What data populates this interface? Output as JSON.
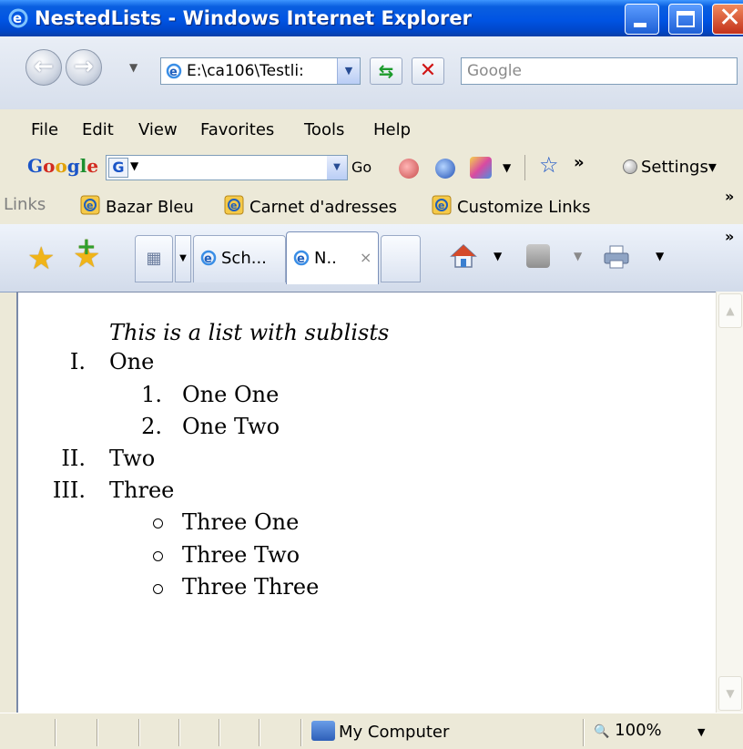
{
  "window": {
    "title": "NestedLists - Windows Internet Explorer",
    "minimize_icon": "minimize-icon",
    "maximize_icon": "maximize-icon",
    "close_icon": "close-icon"
  },
  "navigation": {
    "address": "E:\\ca106\\Testli:",
    "search_placeholder": "Google"
  },
  "menu": {
    "items": [
      "File",
      "Edit",
      "View",
      "Favorites",
      "Tools",
      "Help"
    ]
  },
  "google_toolbar": {
    "logo": [
      "G",
      "o",
      "o",
      "g",
      "l",
      "e"
    ],
    "g_icon": "G",
    "go_label": "Go",
    "more": "»",
    "settings_label": "Settings"
  },
  "links_bar": {
    "label": "Links",
    "items": [
      "Bazar Bleu",
      "Carnet d'adresses",
      "Customize Links"
    ],
    "more": "»"
  },
  "tabs": {
    "items": [
      {
        "label": "Sch...",
        "active": false
      },
      {
        "label": "N..",
        "active": true
      }
    ],
    "close_glyph": "×",
    "more": "»"
  },
  "document": {
    "caption": "This is a list with sublists",
    "items": [
      {
        "marker": "I.",
        "text": "One",
        "children": [
          {
            "marker": "1.",
            "text": "One One"
          },
          {
            "marker": "2.",
            "text": "One Two"
          }
        ]
      },
      {
        "marker": "II.",
        "text": "Two",
        "children": []
      },
      {
        "marker": "III.",
        "text": "Three",
        "children": [
          {
            "marker": "circle",
            "text": "Three One"
          },
          {
            "marker": "circle",
            "text": "Three Two"
          },
          {
            "marker": "circle",
            "text": "Three Three"
          }
        ]
      }
    ]
  },
  "statusbar": {
    "zone": "My Computer",
    "zoom": "100%"
  },
  "colors": {
    "titlebar": "#0054e3",
    "close_button": "#c3311b",
    "content_bg": "#ffffff"
  }
}
